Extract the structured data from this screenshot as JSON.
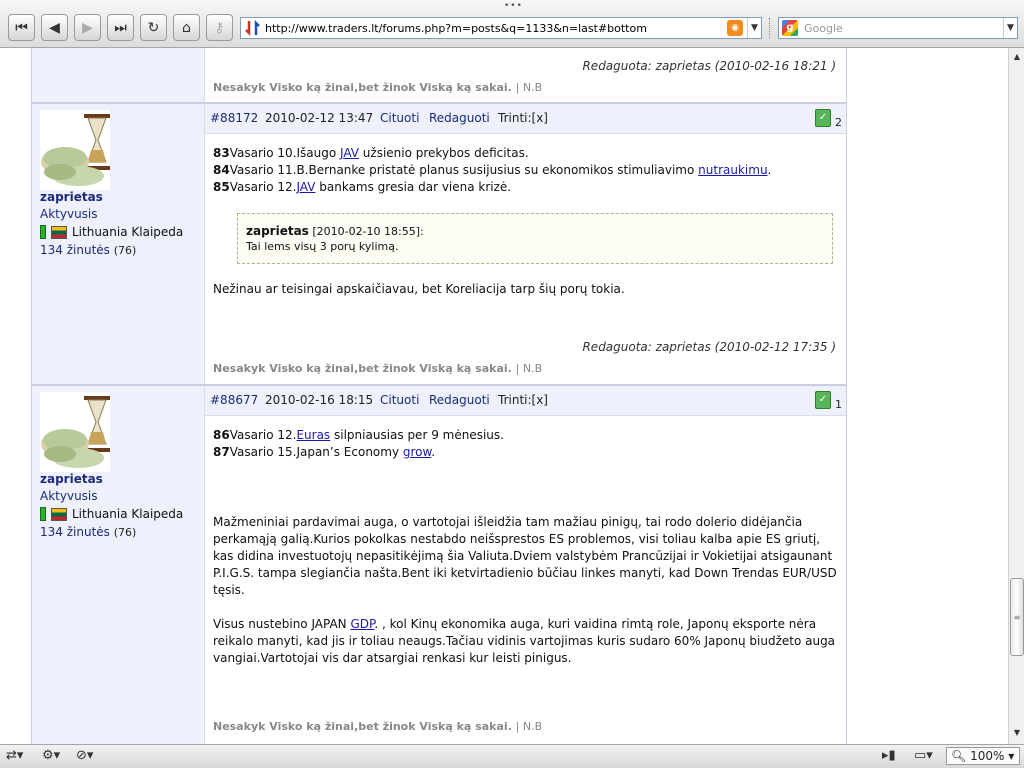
{
  "browser": {
    "url": "http://www.traders.lt/forums.php?m=posts&q=1133&n=last#bottom",
    "search_placeholder": "Google",
    "zoom": "100%"
  },
  "top_partial": {
    "edited": "Redaguota: zaprietas (2010-02-16 18:21 )",
    "signature": "Nesakyk Visko ką žinai,bet žinok Viską ką sakai.",
    "signature_tail": "| N.B"
  },
  "posts": [
    {
      "id": "#88172",
      "date": "2010-02-12 13:47",
      "quote_label": "Cituoti",
      "edit_label": "Redaguoti",
      "delete_label": "Trinti:[x]",
      "likes": "2",
      "user": {
        "name": "zaprietas",
        "rank": "Aktyvusis",
        "location": "Lithuania Klaipeda",
        "posts_link": "134 žinutės",
        "posts_count": "(76)"
      },
      "lines": [
        {
          "num": "83",
          "pre": "Vasario 10.Išaugo ",
          "link": "JAV",
          "post": " užsienio prekybos deficitas."
        },
        {
          "num": "84",
          "pre": "Vasario 11.B.Bernanke pristatė planus susijusius su ekonomikos stimuliavimo ",
          "link": "nutraukimu",
          "post": "."
        },
        {
          "num": "85",
          "pre": "Vasario 12.",
          "link": "JAV",
          "post": " bankams gresia dar viena krizė."
        }
      ],
      "quote": {
        "author": "zaprietas",
        "date": "[2010-02-10 18:55]:",
        "text": "Tai lems visų 3 porų kylimą."
      },
      "paragraph": "Nežinau ar teisingai apskaičiavau, bet Koreliacija tarp šių porų tokia.",
      "edited": "Redaguota: zaprietas (2010-02-12 17:35 )",
      "signature": "Nesakyk Visko ką žinai,bet žinok Viską ką sakai.",
      "signature_tail": "| N.B"
    },
    {
      "id": "#88677",
      "date": "2010-02-16 18:15",
      "quote_label": "Cituoti",
      "edit_label": "Redaguoti",
      "delete_label": "Trinti:[x]",
      "likes": "1",
      "user": {
        "name": "zaprietas",
        "rank": "Aktyvusis",
        "location": "Lithuania Klaipeda",
        "posts_link": "134 žinutės",
        "posts_count": "(76)"
      },
      "lines": [
        {
          "num": "86",
          "pre": "Vasario 12.",
          "link": "Euras",
          "post": " silpniausias per 9 mėnesius."
        },
        {
          "num": "87",
          "pre": "Vasario 15.Japan’s Economy ",
          "link": "grow",
          "post": "."
        }
      ],
      "paragraph1": "Mažmeniniai pardavimai auga, o vartotojai išleidžia tam mažiau pinigų, tai rodo dolerio didėjančia perkamąją galią.Kurios pokolkas nestabdo neišsprestos ES problemos, visi toliau kalba apie ES griutį, kas didina investuotojų nepasitikėjimą šia Valiuta.Dviem valstybėm Prancūzijai ir Vokietijai atsigaunant P.I.G.S. tampa slegiančia našta.Bent iki ketvirtadienio būčiau linkes manyti, kad Down Trendas EUR/USD tęsis.",
      "paragraph2_pre": "Visus nustebino JAPAN ",
      "paragraph2_link": "GDP",
      "paragraph2_post": ". , kol Kinų ekonomika auga, kuri vaidina rimtą role, Japonų eksporte nėra reikalo manyti, kad jis ir toliau neaugs.Tačiau vidinis vartojimas kuris sudaro 60% Japonų biudžeto auga vangiai.Vartotojai vis dar atsargiai renkasi kur leisti pinigus.",
      "signature": "Nesakyk Visko ką žinai,bet žinok Viską ką sakai.",
      "signature_tail": "| N.B"
    }
  ]
}
